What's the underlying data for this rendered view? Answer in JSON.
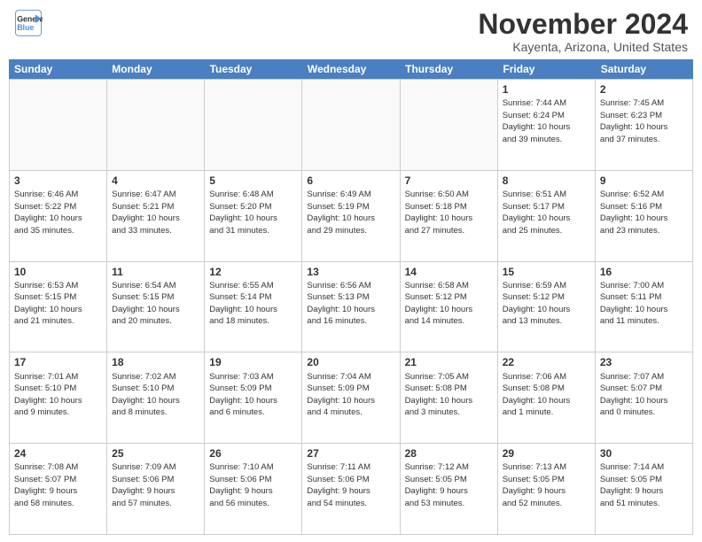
{
  "header": {
    "logo_line1": "General",
    "logo_line2": "Blue",
    "month_title": "November 2024",
    "location": "Kayenta, Arizona, United States"
  },
  "days_of_week": [
    "Sunday",
    "Monday",
    "Tuesday",
    "Wednesday",
    "Thursday",
    "Friday",
    "Saturday"
  ],
  "weeks": [
    [
      {
        "day": "",
        "info": ""
      },
      {
        "day": "",
        "info": ""
      },
      {
        "day": "",
        "info": ""
      },
      {
        "day": "",
        "info": ""
      },
      {
        "day": "",
        "info": ""
      },
      {
        "day": "1",
        "info": "Sunrise: 7:44 AM\nSunset: 6:24 PM\nDaylight: 10 hours\nand 39 minutes."
      },
      {
        "day": "2",
        "info": "Sunrise: 7:45 AM\nSunset: 6:23 PM\nDaylight: 10 hours\nand 37 minutes."
      }
    ],
    [
      {
        "day": "3",
        "info": "Sunrise: 6:46 AM\nSunset: 5:22 PM\nDaylight: 10 hours\nand 35 minutes."
      },
      {
        "day": "4",
        "info": "Sunrise: 6:47 AM\nSunset: 5:21 PM\nDaylight: 10 hours\nand 33 minutes."
      },
      {
        "day": "5",
        "info": "Sunrise: 6:48 AM\nSunset: 5:20 PM\nDaylight: 10 hours\nand 31 minutes."
      },
      {
        "day": "6",
        "info": "Sunrise: 6:49 AM\nSunset: 5:19 PM\nDaylight: 10 hours\nand 29 minutes."
      },
      {
        "day": "7",
        "info": "Sunrise: 6:50 AM\nSunset: 5:18 PM\nDaylight: 10 hours\nand 27 minutes."
      },
      {
        "day": "8",
        "info": "Sunrise: 6:51 AM\nSunset: 5:17 PM\nDaylight: 10 hours\nand 25 minutes."
      },
      {
        "day": "9",
        "info": "Sunrise: 6:52 AM\nSunset: 5:16 PM\nDaylight: 10 hours\nand 23 minutes."
      }
    ],
    [
      {
        "day": "10",
        "info": "Sunrise: 6:53 AM\nSunset: 5:15 PM\nDaylight: 10 hours\nand 21 minutes."
      },
      {
        "day": "11",
        "info": "Sunrise: 6:54 AM\nSunset: 5:15 PM\nDaylight: 10 hours\nand 20 minutes."
      },
      {
        "day": "12",
        "info": "Sunrise: 6:55 AM\nSunset: 5:14 PM\nDaylight: 10 hours\nand 18 minutes."
      },
      {
        "day": "13",
        "info": "Sunrise: 6:56 AM\nSunset: 5:13 PM\nDaylight: 10 hours\nand 16 minutes."
      },
      {
        "day": "14",
        "info": "Sunrise: 6:58 AM\nSunset: 5:12 PM\nDaylight: 10 hours\nand 14 minutes."
      },
      {
        "day": "15",
        "info": "Sunrise: 6:59 AM\nSunset: 5:12 PM\nDaylight: 10 hours\nand 13 minutes."
      },
      {
        "day": "16",
        "info": "Sunrise: 7:00 AM\nSunset: 5:11 PM\nDaylight: 10 hours\nand 11 minutes."
      }
    ],
    [
      {
        "day": "17",
        "info": "Sunrise: 7:01 AM\nSunset: 5:10 PM\nDaylight: 10 hours\nand 9 minutes."
      },
      {
        "day": "18",
        "info": "Sunrise: 7:02 AM\nSunset: 5:10 PM\nDaylight: 10 hours\nand 8 minutes."
      },
      {
        "day": "19",
        "info": "Sunrise: 7:03 AM\nSunset: 5:09 PM\nDaylight: 10 hours\nand 6 minutes."
      },
      {
        "day": "20",
        "info": "Sunrise: 7:04 AM\nSunset: 5:09 PM\nDaylight: 10 hours\nand 4 minutes."
      },
      {
        "day": "21",
        "info": "Sunrise: 7:05 AM\nSunset: 5:08 PM\nDaylight: 10 hours\nand 3 minutes."
      },
      {
        "day": "22",
        "info": "Sunrise: 7:06 AM\nSunset: 5:08 PM\nDaylight: 10 hours\nand 1 minute."
      },
      {
        "day": "23",
        "info": "Sunrise: 7:07 AM\nSunset: 5:07 PM\nDaylight: 10 hours\nand 0 minutes."
      }
    ],
    [
      {
        "day": "24",
        "info": "Sunrise: 7:08 AM\nSunset: 5:07 PM\nDaylight: 9 hours\nand 58 minutes."
      },
      {
        "day": "25",
        "info": "Sunrise: 7:09 AM\nSunset: 5:06 PM\nDaylight: 9 hours\nand 57 minutes."
      },
      {
        "day": "26",
        "info": "Sunrise: 7:10 AM\nSunset: 5:06 PM\nDaylight: 9 hours\nand 56 minutes."
      },
      {
        "day": "27",
        "info": "Sunrise: 7:11 AM\nSunset: 5:06 PM\nDaylight: 9 hours\nand 54 minutes."
      },
      {
        "day": "28",
        "info": "Sunrise: 7:12 AM\nSunset: 5:05 PM\nDaylight: 9 hours\nand 53 minutes."
      },
      {
        "day": "29",
        "info": "Sunrise: 7:13 AM\nSunset: 5:05 PM\nDaylight: 9 hours\nand 52 minutes."
      },
      {
        "day": "30",
        "info": "Sunrise: 7:14 AM\nSunset: 5:05 PM\nDaylight: 9 hours\nand 51 minutes."
      }
    ]
  ]
}
